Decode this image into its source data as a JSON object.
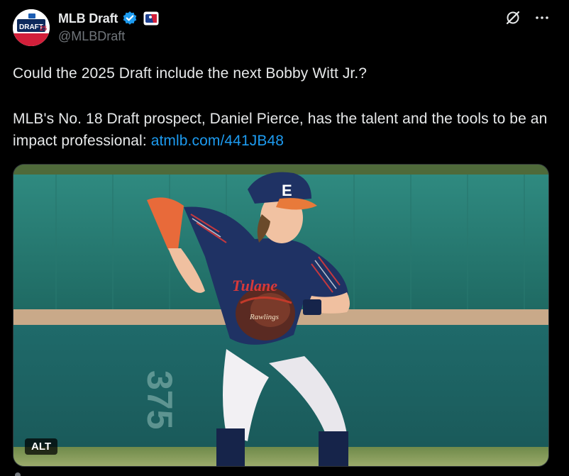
{
  "author": {
    "display_name": "MLB Draft",
    "handle": "@MLBDraft",
    "avatar_text": "DRAFT 25",
    "avatar_icon": "mlb-draft-logo",
    "verified_icon": "verified-badge-icon",
    "affiliate_icon": "mlb-affiliate-icon"
  },
  "actions": {
    "grok_icon": "grok-icon",
    "more_icon": "more-horizontal-icon"
  },
  "tweet": {
    "line1": "Could the 2025 Draft include the next Bobby Witt Jr.?",
    "line2_prefix": "MLB's No. 18 Draft prospect, Daniel Pierce, has the talent and the tools to be an impact professional: ",
    "link_text": "atmlb.com/441JB48"
  },
  "media": {
    "alt_label": "ALT",
    "jersey_number": "E",
    "wall_sign": "375",
    "jersey_script": "Tulane",
    "glove_brand": "Rawlings"
  },
  "colors": {
    "background": "#000000",
    "text": "#e7e9ea",
    "muted": "#71767b",
    "link": "#1d9bf0",
    "verified": "#1d9bf0"
  }
}
